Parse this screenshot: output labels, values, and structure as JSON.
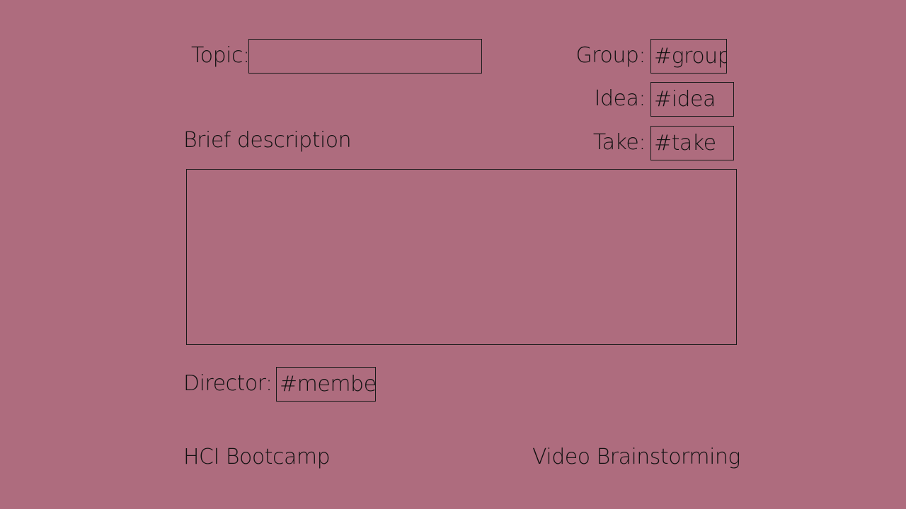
{
  "form": {
    "topic_label": "Topic:",
    "topic_value": "",
    "group_label": "Group:",
    "group_value": "#group",
    "idea_label": "Idea:",
    "idea_value": "#idea",
    "take_label": "Take:",
    "take_value": "#take",
    "description_label": "Brief description",
    "description_value": "",
    "director_label": "Director:",
    "director_value": "#member"
  },
  "footer": {
    "left": "HCI Bootcamp",
    "right": "Video Brainstorming"
  },
  "colors": {
    "background": "#ae6c7e",
    "text": "#111111",
    "border": "#1a1a1a"
  }
}
